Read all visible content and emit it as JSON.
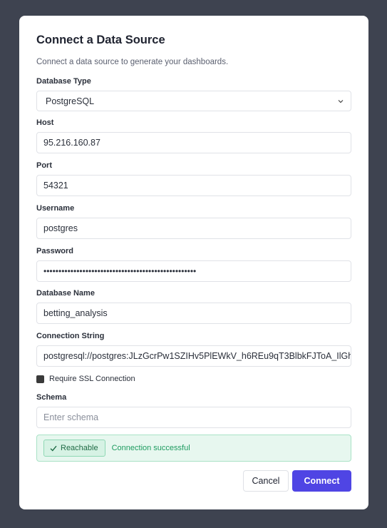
{
  "dialog": {
    "title": "Connect a Data Source",
    "subtitle": "Connect a data source to generate your dashboards."
  },
  "fields": {
    "db_type": {
      "label": "Database Type",
      "value": "PostgreSQL"
    },
    "host": {
      "label": "Host",
      "value": "95.216.160.87"
    },
    "port": {
      "label": "Port",
      "value": "54321"
    },
    "username": {
      "label": "Username",
      "value": "postgres"
    },
    "password": {
      "label": "Password",
      "value": "•••••••••••••••••••••••••••••••••••••••••••••••••••"
    },
    "db_name": {
      "label": "Database Name",
      "value": "betting_analysis"
    },
    "connection_string": {
      "label": "Connection String",
      "value": "postgresql://postgres:JLzGcrPw1SZIHv5PlEWkV_h6REu9qT3BlbkFJToA_IlGh"
    },
    "ssl": {
      "label": "Require SSL Connection",
      "checked": true
    },
    "schema": {
      "label": "Schema",
      "placeholder": "Enter schema",
      "value": ""
    }
  },
  "status": {
    "badge_label": "Reachable",
    "message": "Connection successful"
  },
  "buttons": {
    "cancel": "Cancel",
    "connect": "Connect"
  },
  "colors": {
    "backdrop": "#3e4350",
    "accent": "#4f45e4",
    "success_bg": "#e7f7ef",
    "success_text": "#1d9b5f"
  }
}
